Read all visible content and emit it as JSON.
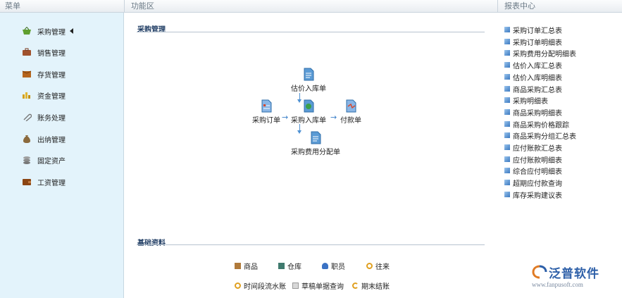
{
  "header": {
    "menu": "菜单",
    "func": "功能区",
    "report": "报表中心"
  },
  "sidebar": {
    "items": [
      {
        "label": "采购管理",
        "icon": "basket-icon",
        "color": "#5f9f2f",
        "active": true
      },
      {
        "label": "销售管理",
        "icon": "briefcase-icon",
        "color": "#a0522d"
      },
      {
        "label": "存货管理",
        "icon": "box-icon",
        "color": "#b5651d"
      },
      {
        "label": "资金管理",
        "icon": "coins-icon",
        "color": "#d4a017"
      },
      {
        "label": "账务处理",
        "icon": "paperclip-icon",
        "color": "#777777"
      },
      {
        "label": "出纳管理",
        "icon": "money-bag-icon",
        "color": "#8b6a3d"
      },
      {
        "label": "固定资产",
        "icon": "stack-icon",
        "color": "#8c8c8c"
      },
      {
        "label": "工资管理",
        "icon": "wallet-icon",
        "color": "#8b4513"
      }
    ]
  },
  "func": {
    "purchase_title": "采购管理",
    "flow": {
      "estimate": "估价入库单",
      "order": "采购订单",
      "receipt": "采购入库单",
      "payment": "付款单",
      "allocation": "采购费用分配单",
      "arrow": "→"
    },
    "basic_title": "基础资料",
    "basic_items": [
      {
        "label": "商品",
        "icon": "goods-icon",
        "color": "#b07a3a"
      },
      {
        "label": "仓库",
        "icon": "warehouse-icon",
        "color": "#3f7a6e"
      },
      {
        "label": "职员",
        "icon": "staff-icon",
        "color": "#3a72c4"
      },
      {
        "label": "往来",
        "icon": "contact-icon",
        "color": "#e0a020"
      },
      {
        "label": "时间段流水账",
        "icon": "time-ledger-icon",
        "color": "#e0a020"
      },
      {
        "label": "草稿单据查询",
        "icon": "draft-query-icon",
        "color": "#9a9a9a"
      },
      {
        "label": "期末结账",
        "icon": "period-close-icon",
        "color": "#e0a020"
      }
    ]
  },
  "reports": {
    "items": [
      "采购订单汇总表",
      "采购订单明细表",
      "采购费用分配明细表",
      "估价入库汇总表",
      "估价入库明细表",
      "商品采购汇总表",
      "采购明细表",
      "商品采购明细表",
      "商品采购价格跟踪",
      "商品采购分组汇总表",
      "应付账款汇总表",
      "应付账款明细表",
      "综合应付明细表",
      "超期应付款查询",
      "库存采购建议表"
    ]
  },
  "logo": {
    "text": "泛普软件",
    "url": "www.fanpusoft.com"
  }
}
